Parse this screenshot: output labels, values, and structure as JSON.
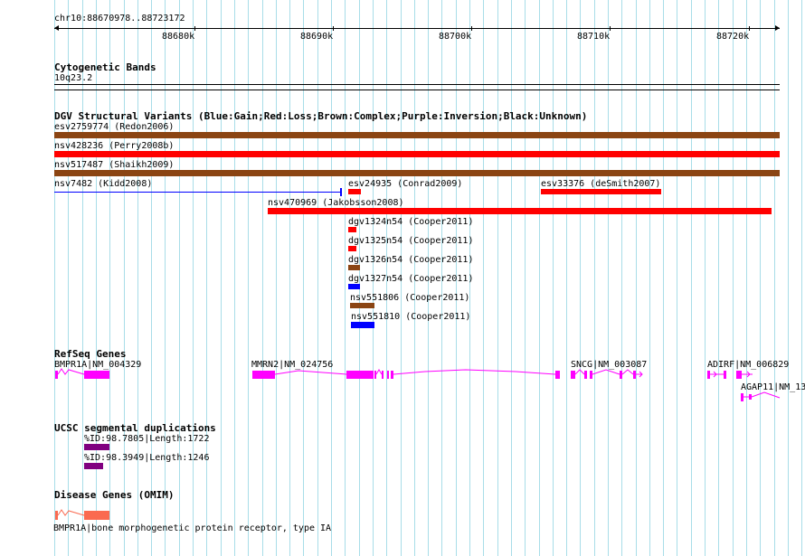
{
  "ruler": {
    "range": "chr10:88670978..88723172",
    "ticks": [
      "88680k",
      "88690k",
      "88700k",
      "88710k",
      "88720k"
    ]
  },
  "cytoband": {
    "title": "Cytogenetic Bands",
    "band": "10q23.2"
  },
  "dgv": {
    "title": "DGV Structural Variants (Blue:Gain;Red:Loss;Brown:Complex;Purple:Inversion;Black:Unknown)",
    "items": [
      {
        "label": "esv2759774 (Redon2006)",
        "color": "#8b4513"
      },
      {
        "label": "nsv428236 (Perry2008b)",
        "color": "#ff0000"
      },
      {
        "label": "nsv517487 (Shaikh2009)",
        "color": "#8b4513"
      },
      {
        "label": "nsv7482 (Kidd2008)",
        "color": "#0000ff"
      },
      {
        "label": "esv24935 (Conrad2009)",
        "color": "#ff0000"
      },
      {
        "label": "esv33376 (deSmith2007)",
        "color": "#ff0000"
      },
      {
        "label": "nsv470969 (Jakobsson2008)",
        "color": "#ff0000"
      },
      {
        "label": "dgv1324n54 (Cooper2011)",
        "color": "#ff0000"
      },
      {
        "label": "dgv1325n54 (Cooper2011)",
        "color": "#ff0000"
      },
      {
        "label": "dgv1326n54 (Cooper2011)",
        "color": "#8b4513"
      },
      {
        "label": "dgv1327n54 (Cooper2011)",
        "color": "#0000ff"
      },
      {
        "label": "nsv551806 (Cooper2011)",
        "color": "#8b4513"
      },
      {
        "label": "nsv551810 (Cooper2011)",
        "color": "#0000ff"
      }
    ]
  },
  "refseq": {
    "title": "RefSeq Genes",
    "color": "#ff00ff",
    "genes": [
      {
        "label": "BMPR1A|NM_004329"
      },
      {
        "label": "MMRN2|NM_024756"
      },
      {
        "label": "SNCG|NM_003087"
      },
      {
        "label": "ADIRF|NM_006829"
      },
      {
        "label": "AGAP11|NM_13"
      }
    ]
  },
  "segdups": {
    "title": "UCSC segmental duplications",
    "color": "#800080",
    "items": [
      {
        "label": "%ID:98.7805|Length:1722"
      },
      {
        "label": "%ID:98.3949|Length:1246"
      }
    ]
  },
  "omim": {
    "title": "Disease Genes (OMIM)",
    "color": "#fa6a50",
    "label": "BMPR1A|bone morphogenetic protein receptor, type IA"
  }
}
